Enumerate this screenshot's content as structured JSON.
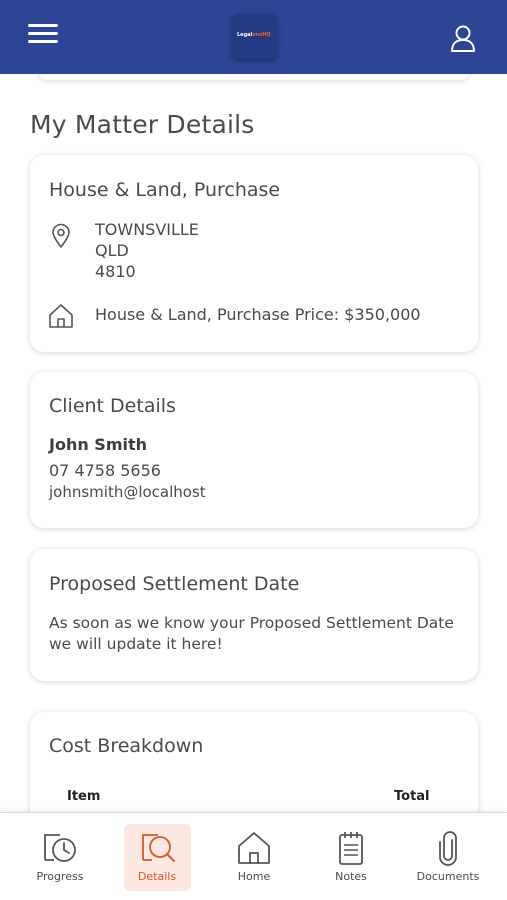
{
  "header": {
    "logo_text_a": "Legal",
    "logo_text_b": "onsHQ",
    "menu_icon": "hamburger-icon",
    "profile_icon": "user-icon"
  },
  "page": {
    "title": "My Matter Details"
  },
  "property": {
    "title": "House & Land, Purchase",
    "address_line1": "TOWNSVILLE",
    "address_line2": "QLD",
    "address_line3": "4810",
    "price_text": "House & Land, Purchase Price: $350,000"
  },
  "client": {
    "title": "Client Details",
    "name": "John Smith",
    "phone": "07 4758 5656",
    "email": "johnsmith@localhost"
  },
  "settlement": {
    "title": "Proposed Settlement Date",
    "message": "As soon as we know your Proposed Settlement Date we will update it here!"
  },
  "cost": {
    "title": "Cost Breakdown",
    "col_item": "Item",
    "col_total": "Total"
  },
  "nav": {
    "items": [
      {
        "label": "Progress",
        "icon": "progress-clock-icon"
      },
      {
        "label": "Details",
        "icon": "details-search-icon",
        "active": true
      },
      {
        "label": "Home",
        "icon": "home-icon"
      },
      {
        "label": "Notes",
        "icon": "notes-icon"
      },
      {
        "label": "Documents",
        "icon": "paperclip-icon"
      }
    ]
  },
  "colors": {
    "header_bg": "#2e4494",
    "accent": "#d9552b",
    "active_bg": "#fde8e2",
    "text": "#4a4a4a"
  }
}
